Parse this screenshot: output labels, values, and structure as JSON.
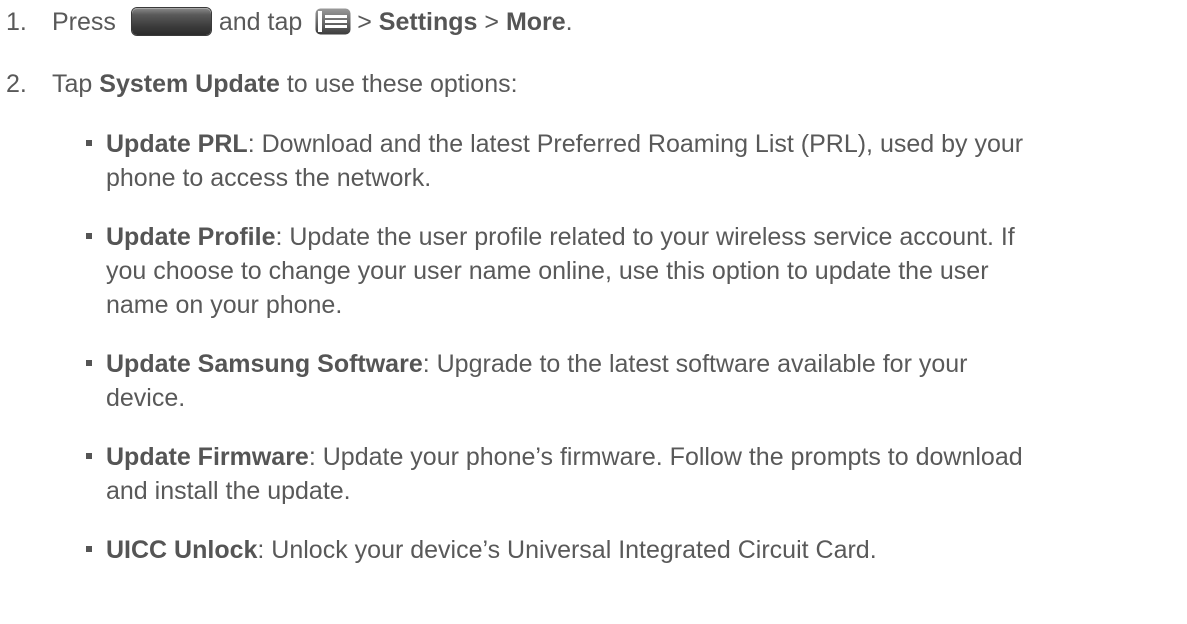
{
  "step1": {
    "number": "1.",
    "press": "Press",
    "and_tap": "and tap",
    "sep1": ">",
    "settings": "Settings",
    "sep2": ">",
    "more": "More",
    "end": ".",
    "home_key_icon": "home-key-icon",
    "menu_key_icon": "menu-key-icon"
  },
  "step2": {
    "number": "2.",
    "tap": "Tap",
    "system_update": "System Update",
    "rest": "to use these options:"
  },
  "bullets": [
    {
      "title": "Update PRL",
      "text": ": Download and the latest Preferred Roaming List (PRL), used by your\nphone to access the network."
    },
    {
      "title": "Update Profile",
      "text": ": Update the user profile related to your wireless service account. If\nyou choose to change your user name online, use this option to update the user\nname on your phone."
    },
    {
      "title": "Update Samsung Software",
      "text": ": Upgrade to the latest software available for your\ndevice."
    },
    {
      "title": "Update Firmware",
      "text": ": Update your phone’s firmware. Follow the prompts to download\nand install the update."
    },
    {
      "title": "UICC Unlock",
      "text": ": Unlock your device’s Universal Integrated Circuit Card."
    }
  ],
  "colors": {
    "text": "#595959",
    "bold": "#555555",
    "background": "#ffffff"
  }
}
